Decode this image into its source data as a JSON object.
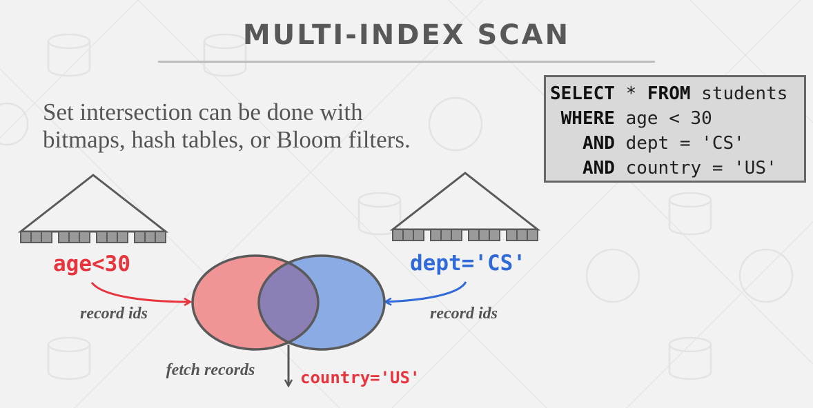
{
  "slide": {
    "title": "MULTI-INDEX SCAN",
    "body_lines": [
      "Set intersection can be done with",
      "bitmaps, hash tables, or Bloom filters."
    ]
  },
  "sql": {
    "lines": [
      {
        "kw": "SELECT",
        "mid": " * ",
        "kw2": "FROM",
        "rest": " students",
        "indent": ""
      },
      {
        "kw": "WHERE",
        "rest": " age < 30",
        "indent": " "
      },
      {
        "kw": "AND",
        "rest": " dept = 'CS'",
        "indent": "   "
      },
      {
        "kw": "AND",
        "rest": " country = 'US'",
        "indent": "   "
      }
    ]
  },
  "diagram": {
    "left_index": {
      "label": "age<30",
      "edge_label": "record ids",
      "color": "#e8343c"
    },
    "right_index": {
      "label": "dept='CS'",
      "edge_label": "record ids",
      "color": "#2f6ad8"
    },
    "venn": {
      "left_fill": "#f09496",
      "right_fill": "#8aabe4",
      "overlap_fill": "#8b7fb5"
    },
    "output": {
      "edge_label": "fetch records",
      "filter_label": "country='US'",
      "filter_color": "#e8343c"
    }
  }
}
